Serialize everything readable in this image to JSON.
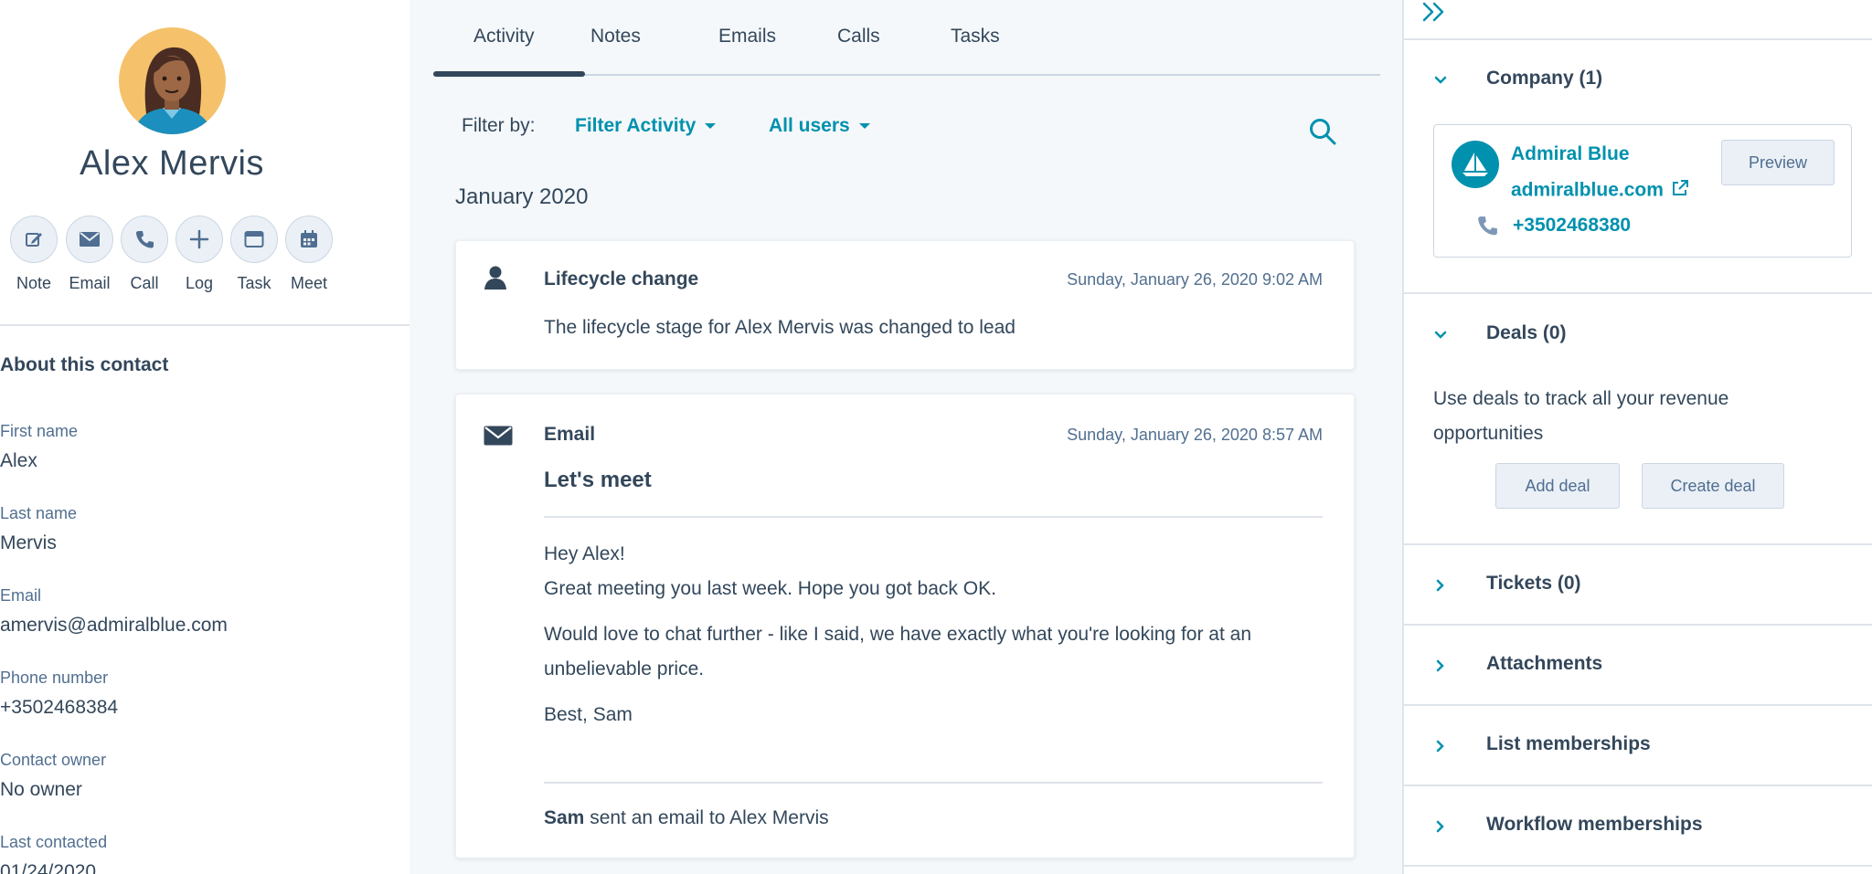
{
  "contact": {
    "name": "Alex Mervis",
    "actions": [
      {
        "label": "Note",
        "icon": "edit-icon"
      },
      {
        "label": "Email",
        "icon": "envelope-icon"
      },
      {
        "label": "Call",
        "icon": "phone-icon"
      },
      {
        "label": "Log",
        "icon": "plus-icon"
      },
      {
        "label": "Task",
        "icon": "task-icon"
      },
      {
        "label": "Meet",
        "icon": "calendar-icon"
      }
    ],
    "about_title": "About this contact",
    "fields": [
      {
        "label": "First name",
        "value": "Alex"
      },
      {
        "label": "Last name",
        "value": "Mervis"
      },
      {
        "label": "Email",
        "value": "amervis@admiralblue.com"
      },
      {
        "label": "Phone number",
        "value": "+3502468384"
      },
      {
        "label": "Contact owner",
        "value": "No owner"
      },
      {
        "label": "Last contacted",
        "value": "01/24/2020"
      }
    ]
  },
  "tabs": [
    "Activity",
    "Notes",
    "Emails",
    "Calls",
    "Tasks"
  ],
  "active_tab": "Activity",
  "filter": {
    "label": "Filter by:",
    "activity": "Filter Activity",
    "users": "All users"
  },
  "month": "January 2020",
  "activities": [
    {
      "type": "Lifecycle change",
      "date": "Sunday, January 26, 2020 9:02 AM",
      "text": "The lifecycle stage for Alex Mervis was changed to lead"
    },
    {
      "type": "Email",
      "date": "Sunday, January 26, 2020 8:57 AM",
      "subject": "Let's meet",
      "body": [
        "Hey Alex!",
        "Great meeting you last week. Hope you got back OK.",
        "Would love to chat further - like I said, we have exactly what you're looking for at an unbelievable price.",
        "Best, Sam"
      ],
      "footer_sender": "Sam",
      "footer_text": " sent an email to Alex Mervis"
    }
  ],
  "sidebar": {
    "company": {
      "title": "Company (1)",
      "name": "Admiral Blue",
      "domain": "admiralblue.com",
      "phone": "+3502468380",
      "preview_label": "Preview"
    },
    "deals": {
      "title": "Deals (0)",
      "description": "Use deals to track all your revenue opportunities",
      "add_label": "Add deal",
      "create_label": "Create deal"
    },
    "sections": [
      "Tickets (0)",
      "Attachments",
      "List memberships",
      "Workflow memberships"
    ]
  },
  "colors": {
    "text": "#33475b",
    "link": "#0091ae",
    "muted": "#516f90",
    "background": "#f5f8fa",
    "border": "#dfe3eb",
    "avatar_bg": "#f5c26b"
  }
}
